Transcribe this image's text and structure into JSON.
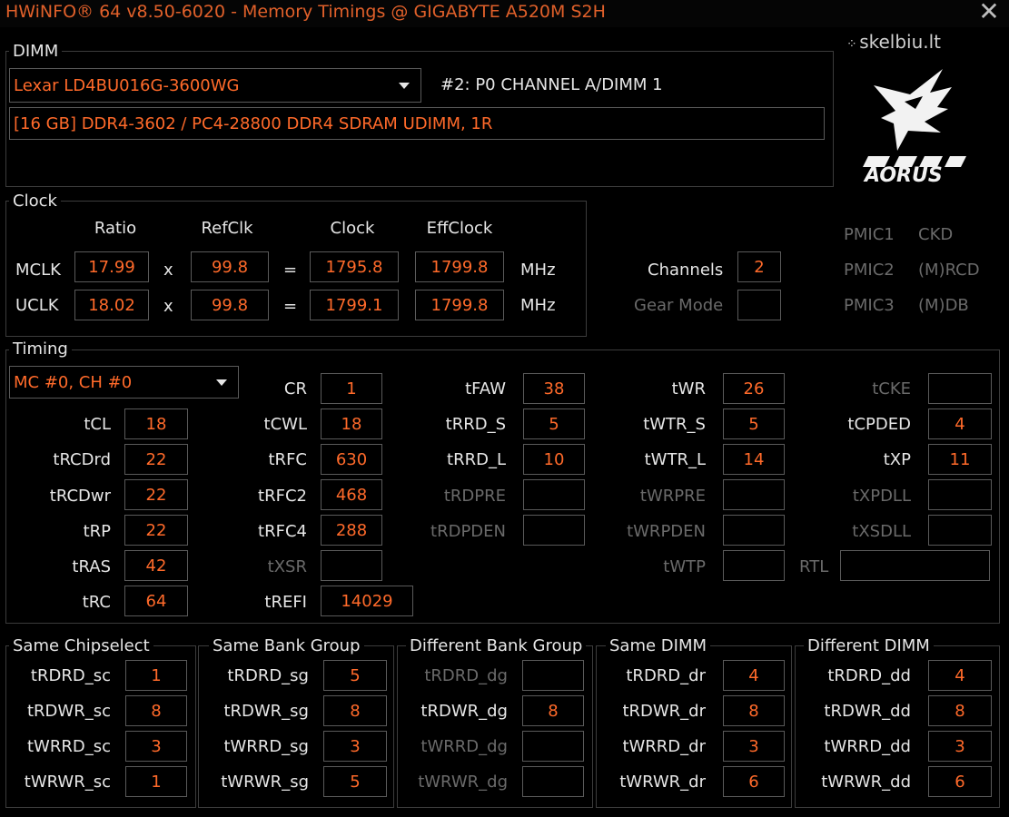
{
  "window": {
    "title": "HWiNFO® 64 v8.50-6020 - Memory Timings @ GIGABYTE A520M S2H",
    "close_icon": "close-icon",
    "watermark": "skelbiu.lt",
    "brand_logo": "AORUS"
  },
  "dimm": {
    "legend": "DIMM",
    "module_select": "Lexar LD4BU016G-3600WG",
    "slot": "#2: P0 CHANNEL A/DIMM 1",
    "description": "[16 GB] DDR4-3602 / PC4-28800 DDR4 SDRAM UDIMM, 1R"
  },
  "clock": {
    "legend": "Clock",
    "headers": {
      "ratio": "Ratio",
      "refclk": "RefClk",
      "clock": "Clock",
      "effclock": "EffClock"
    },
    "x_symbol": "x",
    "eq_symbol": "=",
    "unit": "MHz",
    "mclk": {
      "label": "MCLK",
      "ratio": "17.99",
      "refclk": "99.8",
      "clock": "1795.8",
      "effclock": "1799.8"
    },
    "uclk": {
      "label": "UCLK",
      "ratio": "18.02",
      "refclk": "99.8",
      "clock": "1799.1",
      "effclock": "1799.8"
    },
    "channels_label": "Channels",
    "channels_value": "2",
    "gear_mode_label": "Gear Mode",
    "gear_mode_value": "",
    "pmic": [
      {
        "label": "PMIC1",
        "value": "CKD"
      },
      {
        "label": "PMIC2",
        "value": "(M)RCD"
      },
      {
        "label": "PMIC3",
        "value": "(M)DB"
      }
    ]
  },
  "timing": {
    "legend": "Timing",
    "controller_select": "MC #0, CH #0",
    "col1": [
      {
        "label": "tCL",
        "value": "18"
      },
      {
        "label": "tRCDrd",
        "value": "22"
      },
      {
        "label": "tRCDwr",
        "value": "22"
      },
      {
        "label": "tRP",
        "value": "22"
      },
      {
        "label": "tRAS",
        "value": "42"
      },
      {
        "label": "tRC",
        "value": "64"
      }
    ],
    "col2": [
      {
        "label": "CR",
        "value": "1"
      },
      {
        "label": "tCWL",
        "value": "18"
      },
      {
        "label": "tRFC",
        "value": "630"
      },
      {
        "label": "tRFC2",
        "value": "468"
      },
      {
        "label": "tRFC4",
        "value": "288"
      },
      {
        "label": "tXSR",
        "value": ""
      },
      {
        "label": "tREFI",
        "value": "14029"
      }
    ],
    "col3": [
      {
        "label": "tFAW",
        "value": "38"
      },
      {
        "label": "tRRD_S",
        "value": "5"
      },
      {
        "label": "tRRD_L",
        "value": "10"
      },
      {
        "label": "tRDPRE",
        "value": ""
      },
      {
        "label": "tRDPDEN",
        "value": ""
      }
    ],
    "col4": [
      {
        "label": "tWR",
        "value": "26"
      },
      {
        "label": "tWTR_S",
        "value": "5"
      },
      {
        "label": "tWTR_L",
        "value": "14"
      },
      {
        "label": "tWRPRE",
        "value": ""
      },
      {
        "label": "tWRPDEN",
        "value": ""
      },
      {
        "label": "tWTP",
        "value": ""
      }
    ],
    "col5": [
      {
        "label": "tCKE",
        "value": ""
      },
      {
        "label": "tCPDED",
        "value": "4"
      },
      {
        "label": "tXP",
        "value": "11"
      },
      {
        "label": "tXPDLL",
        "value": ""
      },
      {
        "label": "tXSDLL",
        "value": ""
      }
    ],
    "rtl_label": "RTL",
    "rtl_value": ""
  },
  "groups": [
    {
      "legend": "Same Chipselect",
      "rows": [
        {
          "label": "tRDRD_sc",
          "value": "1"
        },
        {
          "label": "tRDWR_sc",
          "value": "8"
        },
        {
          "label": "tWRRD_sc",
          "value": "3"
        },
        {
          "label": "tWRWR_sc",
          "value": "1"
        }
      ]
    },
    {
      "legend": "Same Bank Group",
      "rows": [
        {
          "label": "tRDRD_sg",
          "value": "5"
        },
        {
          "label": "tRDWR_sg",
          "value": "8"
        },
        {
          "label": "tWRRD_sg",
          "value": "3"
        },
        {
          "label": "tWRWR_sg",
          "value": "5"
        }
      ]
    },
    {
      "legend": "Different Bank Group",
      "rows": [
        {
          "label": "tRDRD_dg",
          "value": ""
        },
        {
          "label": "tRDWR_dg",
          "value": "8"
        },
        {
          "label": "tWRRD_dg",
          "value": ""
        },
        {
          "label": "tWRWR_dg",
          "value": ""
        }
      ]
    },
    {
      "legend": "Same DIMM",
      "rows": [
        {
          "label": "tRDRD_dr",
          "value": "4"
        },
        {
          "label": "tRDWR_dr",
          "value": "8"
        },
        {
          "label": "tWRRD_dr",
          "value": "3"
        },
        {
          "label": "tWRWR_dr",
          "value": "6"
        }
      ]
    },
    {
      "legend": "Different DIMM",
      "rows": [
        {
          "label": "tRDRD_dd",
          "value": "4"
        },
        {
          "label": "tRDWR_dd",
          "value": "8"
        },
        {
          "label": "tWRRD_dd",
          "value": "3"
        },
        {
          "label": "tWRWR_dd",
          "value": "6"
        }
      ]
    }
  ]
}
